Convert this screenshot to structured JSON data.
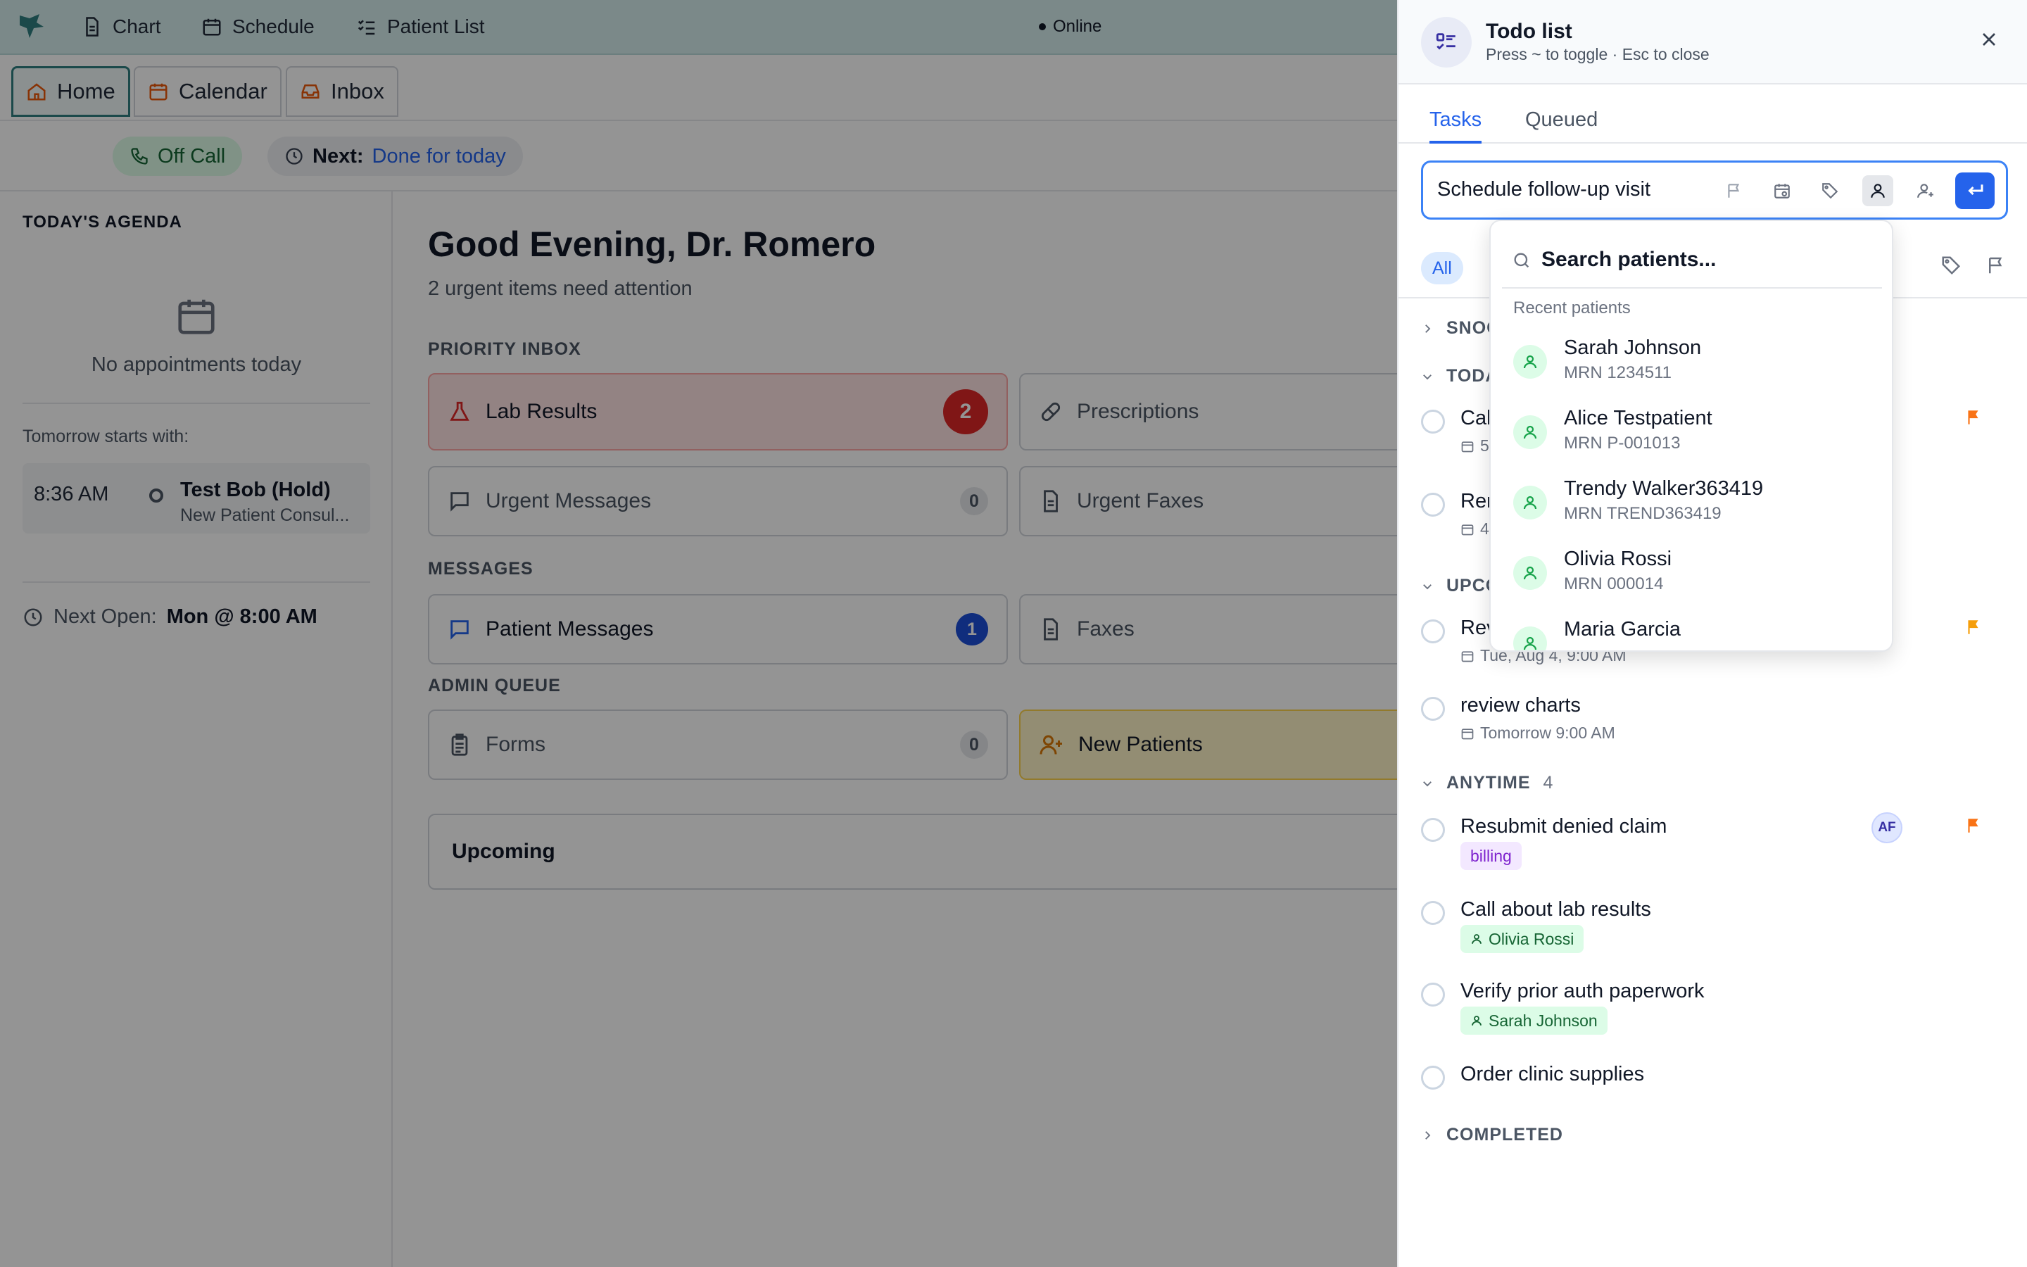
{
  "topnav": {
    "items": [
      {
        "label": "Chart",
        "icon": "document-icon"
      },
      {
        "label": "Schedule",
        "icon": "calendar-icon"
      },
      {
        "label": "Patient List",
        "icon": "checklist-icon"
      }
    ],
    "status": "Online"
  },
  "tabs": [
    {
      "label": "Home",
      "icon": "home-icon",
      "active": true
    },
    {
      "label": "Calendar",
      "icon": "calendar-icon",
      "active": false
    },
    {
      "label": "Inbox",
      "icon": "inbox-icon",
      "active": false
    }
  ],
  "status_row": {
    "call_status": "Off Call",
    "next_label": "Next:",
    "next_value": "Done for today"
  },
  "agenda": {
    "title": "TODAY'S AGENDA",
    "empty_text": "No appointments today",
    "tomorrow_label": "Tomorrow starts with:",
    "tomorrow_appt": {
      "time": "8:36 AM",
      "name": "Test Bob (Hold)",
      "type": "New Patient Consul..."
    },
    "next_open_label": "Next Open:",
    "next_open_value": "Mon @ 8:00 AM"
  },
  "main": {
    "greeting": "Good Evening, Dr. Romero",
    "subtitle": "2 urgent items need attention",
    "sections": {
      "priority": "PRIORITY INBOX",
      "messages": "MESSAGES",
      "admin": "ADMIN QUEUE"
    },
    "cards": {
      "lab_results": {
        "label": "Lab Results",
        "count": "2"
      },
      "prescriptions": {
        "label": "Prescriptions"
      },
      "urgent_messages": {
        "label": "Urgent Messages",
        "count": "0"
      },
      "urgent_faxes": {
        "label": "Urgent Faxes"
      },
      "patient_messages": {
        "label": "Patient Messages",
        "count": "1"
      },
      "faxes": {
        "label": "Faxes"
      },
      "forms": {
        "label": "Forms",
        "count": "0"
      },
      "new_patients": {
        "label": "New Patients"
      }
    },
    "upcoming": "Upcoming"
  },
  "todo": {
    "title": "Todo list",
    "hint_press": "Press",
    "hint_key": "~",
    "hint_rest": "to toggle · Esc to close",
    "tabs": [
      "Tasks",
      "Queued"
    ],
    "composer_value": "Schedule follow-up visit",
    "filter_all": "All",
    "groups": {
      "snoozed": "SNOOZED",
      "today": "TODAY",
      "upcoming": "UPCOMING",
      "anytime": "ANYTIME",
      "anytime_count": "4",
      "completed": "COMPLETED"
    },
    "tasks": {
      "today_1": {
        "title": "Call",
        "due": "5"
      },
      "today_2": {
        "title": "Ren",
        "due": "4"
      },
      "upcoming_1": {
        "title": "Rev",
        "due": "Tue, Aug 4, 9:00 AM"
      },
      "upcoming_2": {
        "title": "review charts",
        "due": "Tomorrow 9:00 AM"
      },
      "anytime_1": {
        "title": "Resubmit denied claim",
        "tag": "billing",
        "assignee": "AF"
      },
      "anytime_2": {
        "title": "Call about lab results",
        "patient": "Olivia Rossi"
      },
      "anytime_3": {
        "title": "Verify prior auth paperwork",
        "patient": "Sarah Johnson"
      },
      "anytime_4": {
        "title": "Order clinic supplies"
      }
    }
  },
  "patient_picker": {
    "search_placeholder": "Search patients...",
    "recent_label": "Recent patients",
    "patients": [
      {
        "name": "Sarah Johnson",
        "mrn": "MRN 1234511"
      },
      {
        "name": "Alice Testpatient",
        "mrn": "MRN P-001013"
      },
      {
        "name": "Trendy Walker363419",
        "mrn": "MRN TREND363419"
      },
      {
        "name": "Olivia Rossi",
        "mrn": "MRN 000014"
      },
      {
        "name": "Maria Garcia",
        "mrn": ""
      }
    ]
  },
  "colors": {
    "brand_teal": "#2f7f80",
    "accent_blue": "#2563eb",
    "urgent_red": "#dc2626",
    "flag_orange": "#f97316"
  }
}
